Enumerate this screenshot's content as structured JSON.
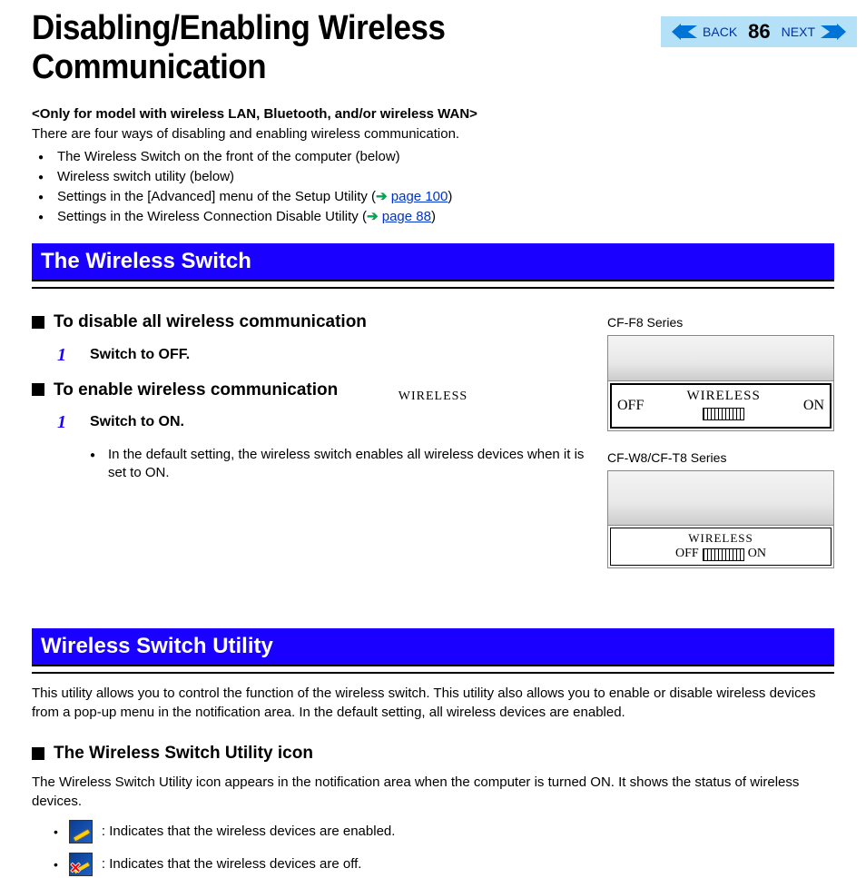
{
  "header": {
    "title": "Disabling/Enabling Wireless Communication",
    "back": "BACK",
    "next": "NEXT",
    "page": "86"
  },
  "intro": {
    "bracket": "<Only for model with wireless LAN, Bluetooth, and/or wireless WAN>",
    "line": "There are four ways of disabling and enabling wireless communication.",
    "b1": "The Wireless Switch on the front of the computer (below)",
    "b2": "Wireless switch utility (below)",
    "b3a": "Settings in the [Advanced] menu of the Setup Utility (",
    "b3link": "page 100",
    "b3b": ")",
    "b4a": "Settings in the Wireless Connection Disable Utility (",
    "b4link": "page 88",
    "b4b": ")"
  },
  "section1": {
    "title": "The Wireless Switch",
    "h1": "To disable all wireless communication",
    "s1num": "1",
    "s1text": "Switch to OFF.",
    "h2": "To enable wireless communication",
    "s2num": "1",
    "s2text": "Switch to ON.",
    "note": "In the default setting, the wireless switch enables all wireless devices when it is set to ON."
  },
  "diagrams": {
    "d1label": "CF-F8 Series",
    "d1off": "OFF",
    "d1wireless": "WIRELESS",
    "d1on": "ON",
    "d2label": "CF-W8/CF-T8 Series",
    "d2wireless": "WIRELESS",
    "d2off": "OFF",
    "d2on": "ON"
  },
  "section2": {
    "title": "Wireless Switch Utility",
    "desc": "This utility allows you to control the function of the wireless switch. This utility also allows you to enable or disable wireless devices from a pop-up menu in the notification area. In the default setting, all wireless devices are enabled.",
    "h1": "The Wireless Switch Utility icon",
    "iconline": "The Wireless Switch Utility icon appears in the notification area when the computer is turned ON. It shows the status of wireless devices.",
    "li1": ":  Indicates that the wireless devices are enabled.",
    "li2": ":  Indicates that the wireless devices are off."
  }
}
